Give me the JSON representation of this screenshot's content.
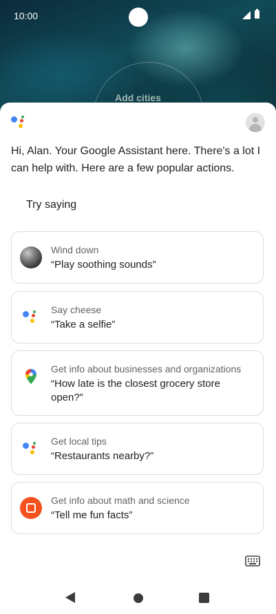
{
  "status_bar": {
    "time": "10:00"
  },
  "wallpaper": {
    "widget_label": "Add cities"
  },
  "assistant": {
    "greeting": "Hi, Alan. Your Google Assistant here. There's a lot I can help with. Here are a few popular actions.",
    "try_saying": "Try saying"
  },
  "suggestions": [
    {
      "category": "Wind down",
      "phrase": "“Play soothing sounds”",
      "icon": "soothing-sounds-thumbnail"
    },
    {
      "category": "Say cheese",
      "phrase": "“Take a selfie”",
      "icon": "assistant-icon"
    },
    {
      "category": "Get info about businesses and organizations",
      "phrase": "“How late is the closest grocery store open?”",
      "icon": "maps-pin-icon"
    },
    {
      "category": "Get local tips",
      "phrase": "“Restaurants nearby?”",
      "icon": "assistant-icon"
    },
    {
      "category": "Get info about math and science",
      "phrase": "“Tell me fun facts”",
      "icon": "sticker-icon"
    }
  ],
  "colors": {
    "google_blue": "#4285F4",
    "google_red": "#EA4335",
    "google_yellow": "#FBBC04",
    "google_green": "#34A853",
    "sticker_orange": "#F4511E"
  }
}
